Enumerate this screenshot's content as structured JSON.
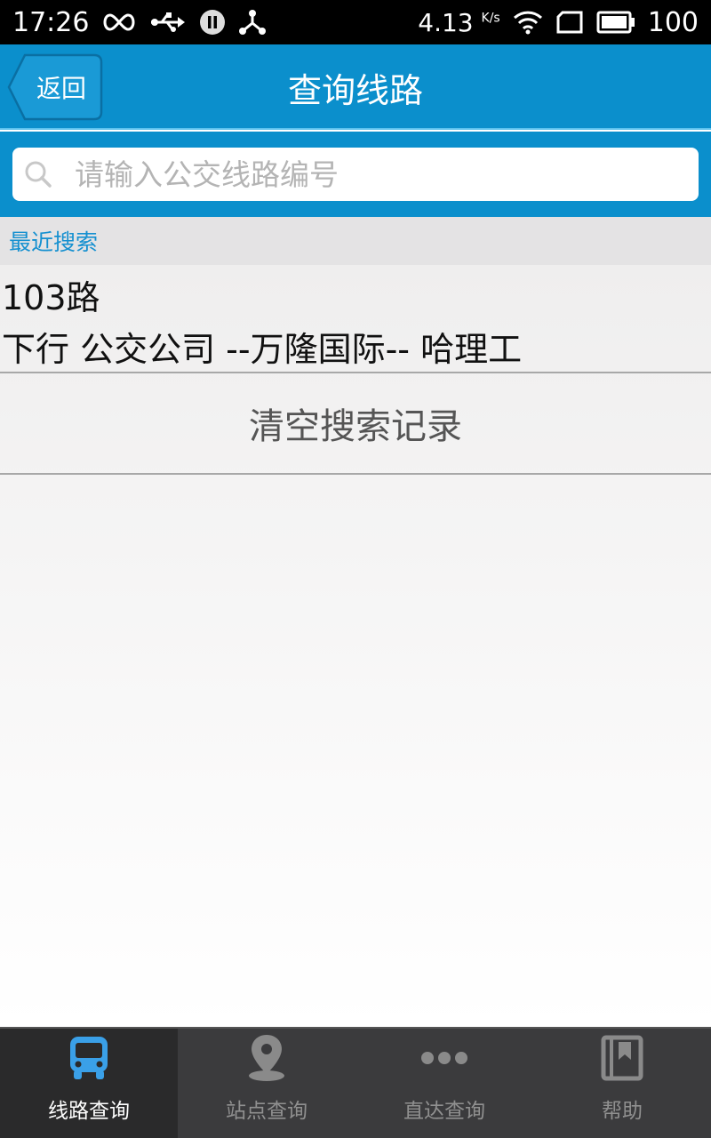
{
  "status_bar": {
    "time": "17:26",
    "net_speed": "4.13",
    "net_unit": "K/s",
    "battery": "100"
  },
  "nav": {
    "back_label": "返回",
    "title": "查询线路"
  },
  "search": {
    "placeholder": "请输入公交线路编号",
    "value": ""
  },
  "recent": {
    "header": "最近搜索",
    "items": [
      {
        "route": "103路",
        "detail": "下行 公交公司 --万隆国际-- 哈理工"
      }
    ],
    "clear_label": "清空搜索记录"
  },
  "tabs": [
    {
      "label": "线路查询",
      "icon": "bus-icon",
      "active": true
    },
    {
      "label": "站点查询",
      "icon": "location-pin-icon",
      "active": false
    },
    {
      "label": "直达查询",
      "icon": "more-dots-icon",
      "active": false
    },
    {
      "label": "帮助",
      "icon": "help-book-icon",
      "active": false
    }
  ],
  "colors": {
    "accent": "#0b8fcc",
    "section_label": "#1590d0",
    "tab_bar": "#3b3b3d",
    "active_tab_icon": "#3aa0e8"
  }
}
